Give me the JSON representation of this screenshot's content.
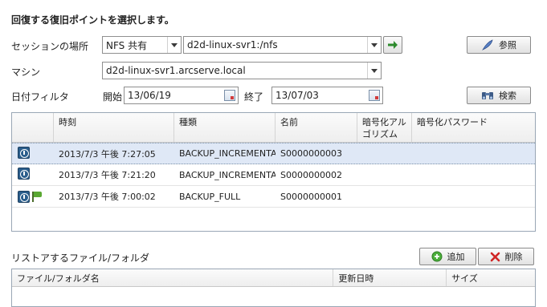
{
  "heading": "回復する復旧ポイントを選択します。",
  "session": {
    "label": "セッションの場所",
    "type_value": "NFS 共有",
    "path_value": "d2d-linux-svr1:/nfs",
    "browse_label": "参照"
  },
  "machine": {
    "label": "マシン",
    "value": "d2d-linux-svr1.arcserve.local"
  },
  "date_filter": {
    "label": "日付フィルタ",
    "start_label": "開始",
    "start_value": "13/06/19",
    "end_label": "終了",
    "end_value": "13/07/03",
    "search_label": "検索"
  },
  "recovery_points": {
    "columns": [
      "時刻",
      "種類",
      "名前",
      "暗号化アル\nゴリズム",
      "暗号化パスワード"
    ],
    "rows": [
      {
        "time": "2013/7/3 午後 7:27:05",
        "type": "BACKUP_INCREMENTAL",
        "name": "S0000000003",
        "selected": true,
        "full": false
      },
      {
        "time": "2013/7/3 午後 7:21:20",
        "type": "BACKUP_INCREMENTAL",
        "name": "S0000000002",
        "selected": false,
        "full": false
      },
      {
        "time": "2013/7/3 午後 7:00:02",
        "type": "BACKUP_FULL",
        "name": "S0000000001",
        "selected": false,
        "full": true
      }
    ]
  },
  "restore_files": {
    "label": "リストアするファイル/フォルダ",
    "add_label": "追加",
    "delete_label": "削除",
    "columns": [
      "ファイル/フォルダ名",
      "更新日時",
      "サイズ"
    ]
  }
}
